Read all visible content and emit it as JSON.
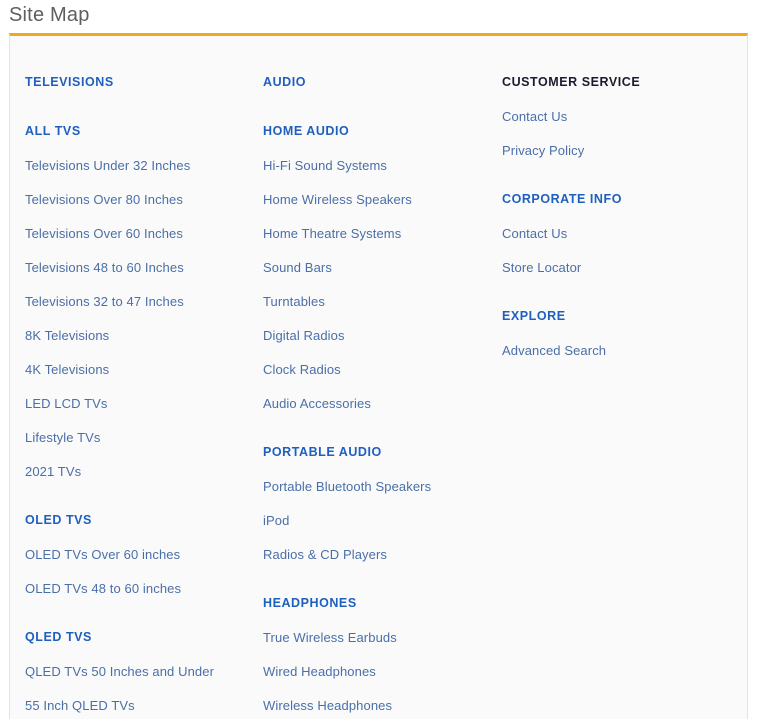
{
  "page": {
    "title": "Site Map",
    "accent_color": "#f0a81e",
    "heading_color": "#1f5fbf",
    "heading_dark_color": "#1b1b2f",
    "link_color": "#4a6fa8",
    "panel_background": "#fafafa",
    "title_color": "#5f5f5f"
  },
  "columns": [
    {
      "name": "televisions",
      "section": "TELEVISIONS",
      "section_style": "blue",
      "groups": [
        {
          "title": "ALL TVS",
          "links": [
            "Televisions Under 32 Inches",
            "Televisions Over 80 Inches",
            "Televisions Over 60 Inches",
            "Televisions 48 to 60 Inches",
            "Televisions 32 to 47 Inches",
            "8K Televisions",
            "4K Televisions",
            "LED LCD TVs",
            "Lifestyle TVs",
            "2021 TVs"
          ]
        },
        {
          "title": "OLED TVS",
          "links": [
            "OLED TVs Over 60 inches",
            "OLED TVs 48 to 60 inches"
          ]
        },
        {
          "title": "QLED TVS",
          "links": [
            "QLED TVs 50 Inches and Under",
            "55 Inch QLED TVs"
          ]
        }
      ]
    },
    {
      "name": "audio",
      "section": "AUDIO",
      "section_style": "blue",
      "groups": [
        {
          "title": "HOME AUDIO",
          "links": [
            "Hi-Fi Sound Systems",
            "Home Wireless Speakers",
            "Home Theatre Systems",
            "Sound Bars",
            "Turntables",
            "Digital Radios",
            "Clock Radios",
            "Audio Accessories"
          ]
        },
        {
          "title": "PORTABLE AUDIO",
          "links": [
            "Portable Bluetooth Speakers",
            "iPod",
            "Radios & CD Players"
          ]
        },
        {
          "title": "HEADPHONES",
          "links": [
            "True Wireless Earbuds",
            "Wired Headphones",
            "Wireless Headphones"
          ]
        }
      ]
    },
    {
      "name": "service",
      "section": "CUSTOMER SERVICE",
      "section_style": "dark",
      "groups": [
        {
          "title": null,
          "links": [
            "Contact Us",
            "Privacy Policy"
          ]
        },
        {
          "title": "CORPORATE INFO",
          "title_style": "dark",
          "links": [
            "Contact Us",
            "Store Locator"
          ]
        },
        {
          "title": "EXPLORE",
          "title_style": "dark",
          "links": [
            "Advanced Search"
          ]
        }
      ]
    }
  ]
}
